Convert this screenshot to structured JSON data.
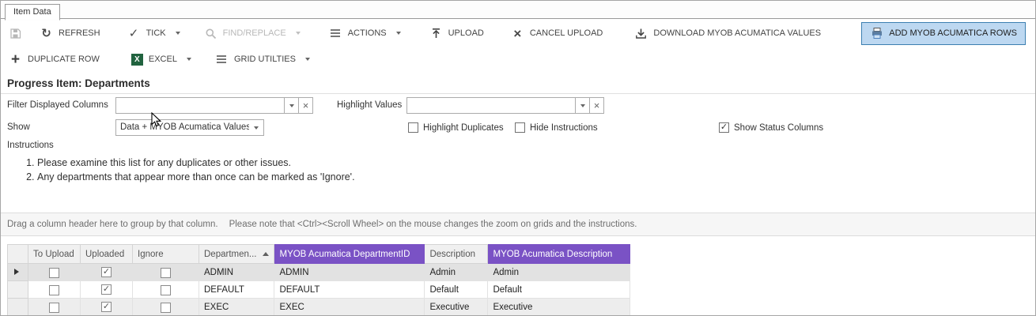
{
  "window": {
    "tab_label": "Item Data"
  },
  "toolbar": {
    "refresh": "REFRESH",
    "tick": "TICK",
    "find_replace": "FIND/REPLACE",
    "actions": "ACTIONS",
    "upload": "UPLOAD",
    "cancel_upload": "CANCEL UPLOAD",
    "download": "DOWNLOAD MYOB ACUMATICA VALUES",
    "add_rows": "ADD MYOB ACUMATICA ROWS",
    "duplicate_row": "DUPLICATE ROW",
    "excel": "EXCEL",
    "grid_utilities": "GRID UTILTIES"
  },
  "icons": {
    "refresh": "↻",
    "tick": "✓",
    "cancel": "×",
    "plus": "+",
    "excel_letter": "X",
    "clear": "×"
  },
  "page": {
    "title": "Progress Item: Departments"
  },
  "filters": {
    "filter_displayed_columns_label": "Filter Displayed Columns",
    "filter_displayed_columns_value": "",
    "highlight_values_label": "Highlight Values",
    "highlight_values_value": "",
    "show_label": "Show",
    "show_value": "Data + MYOB Acumatica Values",
    "highlight_duplicates_label": "Highlight Duplicates",
    "highlight_duplicates_checked": "",
    "hide_instructions_label": "Hide Instructions",
    "hide_instructions_checked": "",
    "show_status_columns_label": "Show Status Columns",
    "show_status_columns_checked": "✓"
  },
  "instructions": {
    "label": "Instructions",
    "items": [
      "Please examine this list for any duplicates or other issues.",
      "Any departments that appear more than once can be marked as 'Ignore'."
    ]
  },
  "grid": {
    "group_hint": "Drag a column header here to group by that column.",
    "zoom_hint": "Please note that <Ctrl><Scroll Wheel> on the mouse changes the zoom on grids and the instructions.",
    "sort_column": "Departmen...",
    "sort_direction": "ascending",
    "columns": [
      "To Upload",
      "Uploaded",
      "Ignore",
      "Departmen...",
      "MYOB Acumatica DepartmentID",
      "Description",
      "MYOB Acumatica Description"
    ],
    "rows": [
      {
        "to_upload": "",
        "uploaded": "✓",
        "ignore": "",
        "department": "ADMIN",
        "myob_department_id": "ADMIN",
        "description": "Admin",
        "myob_description": "Admin"
      },
      {
        "to_upload": "",
        "uploaded": "✓",
        "ignore": "",
        "department": "DEFAULT",
        "myob_department_id": "DEFAULT",
        "description": "Default",
        "myob_description": "Default"
      },
      {
        "to_upload": "",
        "uploaded": "✓",
        "ignore": "",
        "department": "EXEC",
        "myob_department_id": "EXEC",
        "description": "Executive",
        "myob_description": "Executive"
      }
    ]
  },
  "colors": {
    "accent_purple": "#7a52c5",
    "active_button_bg": "#bdd8f1",
    "active_button_border": "#3c7fb1",
    "header_gray_bg": "#f0f0f0",
    "row_selected_bg": "#e2e2e2",
    "row_alt_bg": "#ededed"
  }
}
